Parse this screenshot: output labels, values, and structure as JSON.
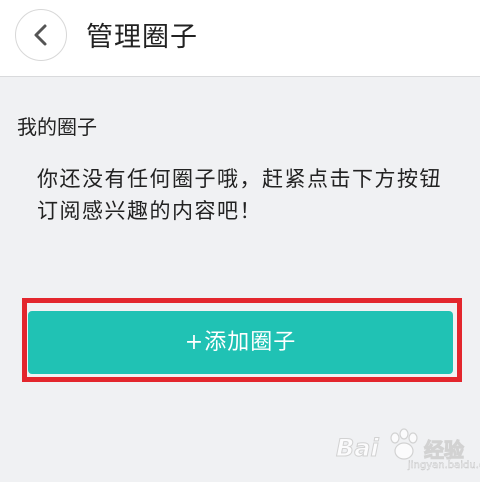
{
  "header": {
    "back_icon": "chevron-left-icon",
    "title": "管理圈子"
  },
  "main": {
    "section_title": "我的圈子",
    "empty_message": "你还没有任何圈子哦，赶紧点击下方按钮订阅感兴趣的内容吧！",
    "add_button_label": "+添加圈子"
  },
  "watermark": {
    "brand": "Bai",
    "brand_cn": "经验",
    "url": "jingyan.baidu.com"
  },
  "colors": {
    "accent": "#20c2b4",
    "highlight": "#e3262d",
    "background": "#f0f1f3"
  }
}
